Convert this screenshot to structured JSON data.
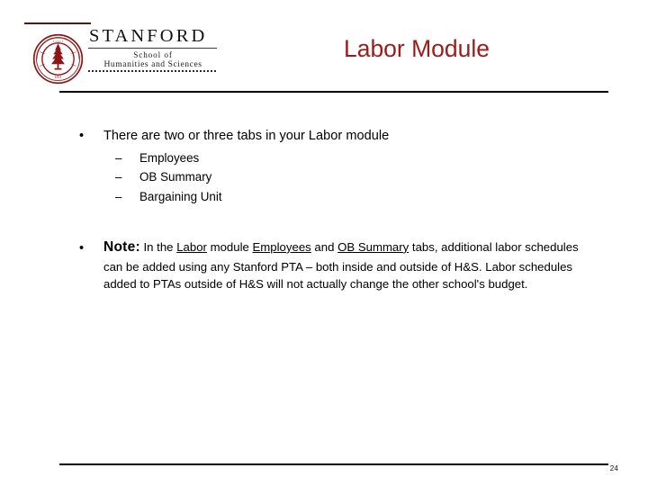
{
  "slide": {
    "title": "Labor Module",
    "page_number": "24",
    "title_color": "#9e1b1b",
    "rule_color": "#000000"
  },
  "logo": {
    "seal_alt": "stanford-seal",
    "wordmark": "STANFORD",
    "school_line1": "School of",
    "school_line2": "Humanities and Sciences",
    "accent_color": "#5a1414"
  },
  "content": {
    "bullet1": {
      "mark": "•",
      "text": "There are two or three tabs in your Labor module"
    },
    "subbullets": [
      {
        "mark": "–",
        "text": "Employees"
      },
      {
        "mark": "–",
        "text": "OB Summary"
      },
      {
        "mark": "–",
        "text": "Bargaining Unit"
      }
    ],
    "note": {
      "mark": "•",
      "label": "Note:",
      "seg1": " In the ",
      "link1": "Labor",
      "seg2": " module ",
      "link2": "Employees",
      "seg3": " and ",
      "link3": "OB Summary",
      "seg4": " tabs, additional labor schedules can be added using any Stanford PTA – both inside and outside of H&S. Labor schedules added to PTAs outside of H&S will not actually change the other school's budget."
    }
  }
}
